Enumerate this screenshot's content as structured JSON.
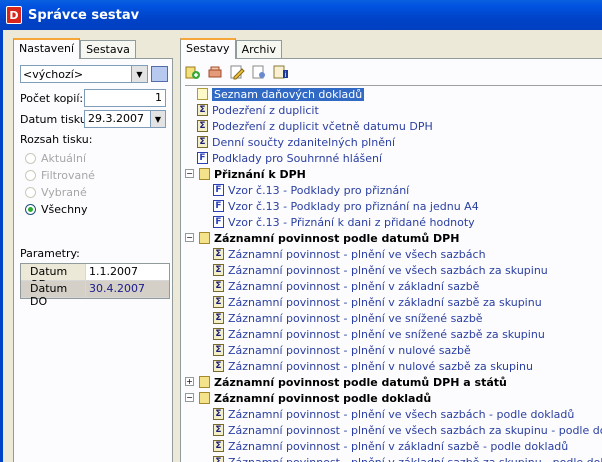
{
  "window": {
    "title": "Správce sestav",
    "app_icon": "D"
  },
  "left_tabs": [
    "Nastavení",
    "Sestava"
  ],
  "right_tabs": [
    "Sestavy",
    "Archiv"
  ],
  "settings": {
    "preset_value": "<výchozí>",
    "copies_label": "Počet kopií:",
    "copies_value": "1",
    "print_date_label": "Datum tisku:",
    "print_date_value": "29.3.2007",
    "range_label": "Rozsah tisku:",
    "range_options": [
      {
        "label": "Aktuální",
        "enabled": false,
        "selected": false
      },
      {
        "label": "Filtrované",
        "enabled": false,
        "selected": false
      },
      {
        "label": "Vybrané",
        "enabled": false,
        "selected": false
      },
      {
        "label": "Všechny",
        "enabled": true,
        "selected": true
      }
    ],
    "params_label": "Parametry:",
    "params": [
      {
        "key": "Datum OD",
        "value": "1.1.2007"
      },
      {
        "key": "Datum DO",
        "value": "30.4.2007"
      }
    ]
  },
  "toolbar_icons": [
    "add-icon",
    "delete-icon",
    "edit-icon",
    "properties-icon",
    "info-icon"
  ],
  "tree": [
    {
      "level": 1,
      "icon": "page",
      "text": "Seznam daňových dokladů",
      "selected": true
    },
    {
      "level": 1,
      "icon": "sum",
      "text": "Podezření z duplicit"
    },
    {
      "level": 1,
      "icon": "sum",
      "text": "Podezření z duplicit včetně datumu DPH"
    },
    {
      "level": 1,
      "icon": "sum",
      "text": "Denní součty zdanitelných plnění"
    },
    {
      "level": 1,
      "icon": "f",
      "text": "Podklady pro Souhrnné hlášení"
    },
    {
      "level": 0,
      "icon": "folder",
      "text": "Přiznání k DPH",
      "bold": true,
      "expander": "−"
    },
    {
      "level": 2,
      "icon": "f",
      "text": "Vzor č.13 - Podklady pro přiznání"
    },
    {
      "level": 2,
      "icon": "f",
      "text": "Vzor č.13 - Podklady pro přiznání na jednu A4"
    },
    {
      "level": 2,
      "icon": "f",
      "text": "Vzor č.13 - Přiznání k dani z přidané hodnoty"
    },
    {
      "level": 0,
      "icon": "folder",
      "text": "Záznamní povinnost podle datumů DPH",
      "bold": true,
      "expander": "−"
    },
    {
      "level": 2,
      "icon": "sum",
      "text": "Záznamní povinnost - plnění ve všech sazbách"
    },
    {
      "level": 2,
      "icon": "sum",
      "text": "Záznamní povinnost - plnění ve všech sazbách za skupinu"
    },
    {
      "level": 2,
      "icon": "sum",
      "text": "Záznamní povinnost - plnění v základní sazbě"
    },
    {
      "level": 2,
      "icon": "sum",
      "text": "Záznamní povinnost - plnění v základní sazbě za skupinu"
    },
    {
      "level": 2,
      "icon": "sum",
      "text": "Záznamní povinnost - plnění ve snížené sazbě"
    },
    {
      "level": 2,
      "icon": "sum",
      "text": "Záznamní povinnost - plnění ve snížené sazbě za skupinu"
    },
    {
      "level": 2,
      "icon": "sum",
      "text": "Záznamní povinnost - plnění v nulové sazbě"
    },
    {
      "level": 2,
      "icon": "sum",
      "text": "Záznamní povinnost - plnění v nulové sazbě za skupinu"
    },
    {
      "level": 0,
      "icon": "folder",
      "text": "Záznamní povinnost podle datumů DPH a států",
      "bold": true,
      "expander": "+"
    },
    {
      "level": 0,
      "icon": "folder",
      "text": "Záznamní povinnost podle dokladů",
      "bold": true,
      "expander": "−"
    },
    {
      "level": 2,
      "icon": "sum",
      "text": "Záznamní povinnost - plnění ve všech sazbách - podle dokladů"
    },
    {
      "level": 2,
      "icon": "sum",
      "text": "Záznamní povinnost - plnění ve všech sazbách za skupinu - podle dokladů"
    },
    {
      "level": 2,
      "icon": "sum",
      "text": "Záznamní povinnost - plnění v základní sazbě - podle dokladů"
    },
    {
      "level": 2,
      "icon": "sum",
      "text": "Záznamní povinnost - plnění v základní sazbě za skupinu - podle dokladů"
    }
  ]
}
